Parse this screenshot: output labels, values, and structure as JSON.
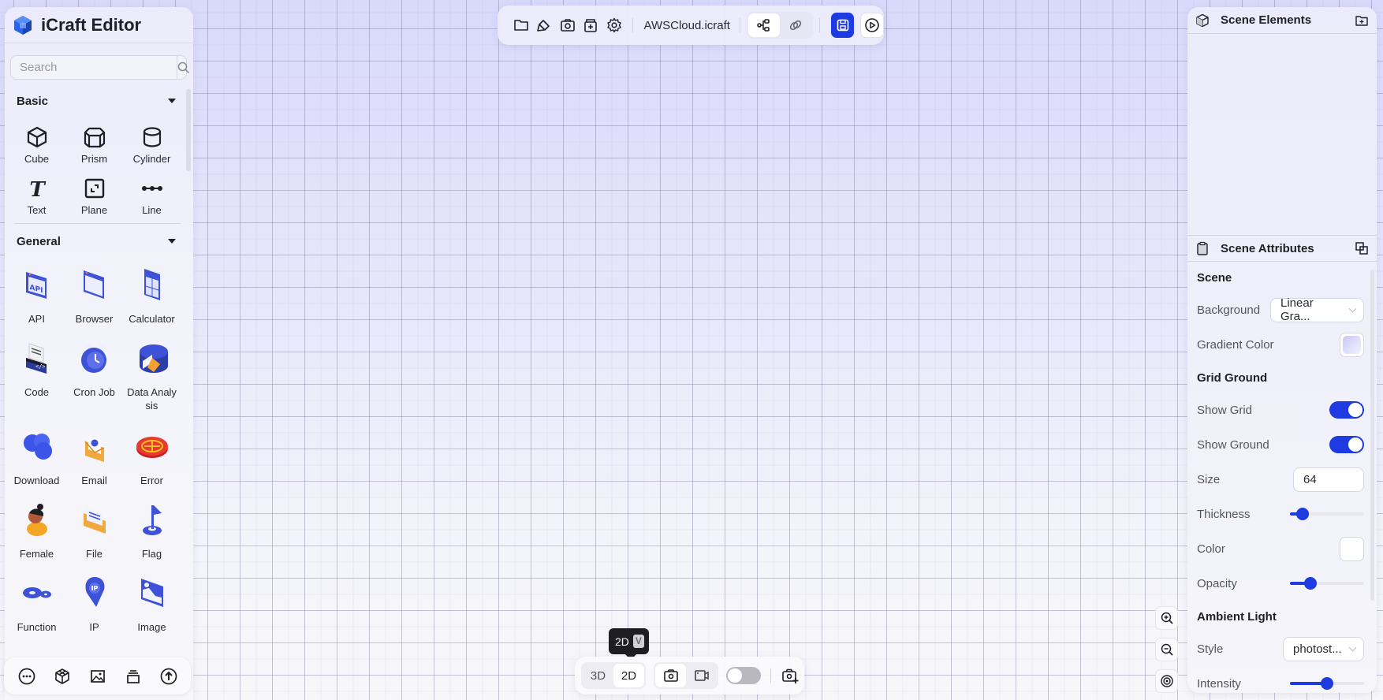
{
  "app": {
    "title": "iCraft Editor"
  },
  "search": {
    "placeholder": "Search",
    "value": ""
  },
  "library": {
    "sections": [
      {
        "title": "Basic",
        "items": [
          {
            "label": "Cube",
            "icon": "cube-icon"
          },
          {
            "label": "Prism",
            "icon": "prism-icon"
          },
          {
            "label": "Cylinder",
            "icon": "cylinder-icon"
          },
          {
            "label": "Text",
            "icon": "text-icon"
          },
          {
            "label": "Plane",
            "icon": "plane-icon"
          },
          {
            "label": "Line",
            "icon": "line-icon"
          }
        ]
      },
      {
        "title": "General",
        "items": [
          {
            "label": "API",
            "icon": "api-icon"
          },
          {
            "label": "Browser",
            "icon": "browser-icon"
          },
          {
            "label": "Calculator",
            "icon": "calculator-icon"
          },
          {
            "label": "Code",
            "icon": "code-icon"
          },
          {
            "label": "Cron Job",
            "icon": "cron-job-icon"
          },
          {
            "label": "Data Analysis",
            "icon": "data-analysis-icon"
          },
          {
            "label": "Download",
            "icon": "download-icon"
          },
          {
            "label": "Email",
            "icon": "email-icon"
          },
          {
            "label": "Error",
            "icon": "error-icon"
          },
          {
            "label": "Female",
            "icon": "female-icon"
          },
          {
            "label": "File",
            "icon": "file-icon"
          },
          {
            "label": "Flag",
            "icon": "flag-icon"
          },
          {
            "label": "Function",
            "icon": "function-icon"
          },
          {
            "label": "IP",
            "icon": "ip-icon"
          },
          {
            "label": "Image",
            "icon": "image-icon"
          }
        ]
      }
    ]
  },
  "footer_tools": [
    "more-icon",
    "model-icon",
    "image-icon",
    "layers-icon",
    "upload-icon"
  ],
  "toolbar": {
    "file_name": "AWSCloud.icraft",
    "buttons": [
      "folder-icon",
      "brush-icon",
      "camera-icon",
      "archive-add-icon",
      "settings-icon"
    ],
    "mode_segment": {
      "active": "graph"
    },
    "save_label": "Save",
    "play_label": "Play"
  },
  "scene_elements": {
    "title": "Scene Elements"
  },
  "scene_attributes": {
    "title": "Scene Attributes",
    "scene": {
      "title": "Scene",
      "background_label": "Background",
      "background_value": "Linear Gra...",
      "gradient_label": "Gradient Color",
      "gradient_color": "#d4d4f8"
    },
    "grid_ground": {
      "title": "Grid Ground",
      "show_grid_label": "Show Grid",
      "show_grid": true,
      "show_ground_label": "Show Ground",
      "show_ground": true,
      "size_label": "Size",
      "size_value": "64",
      "thickness_label": "Thickness",
      "thickness": 0.1,
      "color_label": "Color",
      "color": "#ffffff",
      "opacity_label": "Opacity",
      "opacity": 0.23
    },
    "ambient_light": {
      "title": "Ambient Light",
      "style_label": "Style",
      "style_value": "photost...",
      "intensity_label": "Intensity",
      "intensity": 0.5
    }
  },
  "view": {
    "mode_3d": "3D",
    "mode_2d": "2D",
    "active_mode": "2D",
    "tooltip_label": "2D",
    "tooltip_shortcut": "V",
    "toggle_on": false
  },
  "colors": {
    "accent": "#1d3be0"
  }
}
